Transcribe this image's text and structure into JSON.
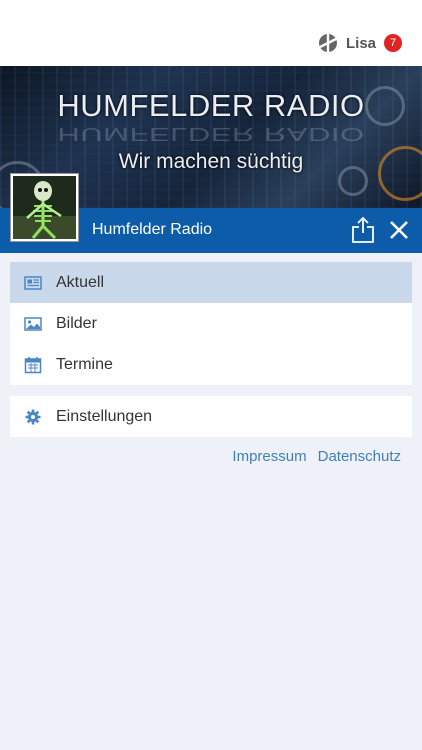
{
  "header": {
    "user_name": "Lisa",
    "notification_count": "7"
  },
  "banner": {
    "title": "HUMFELDER RADIO",
    "subtitle": "Wir machen süchtig"
  },
  "app": {
    "title": "Humfelder Radio"
  },
  "menu": {
    "items": [
      {
        "label": "Aktuell",
        "icon": "newspaper-icon",
        "active": true
      },
      {
        "label": "Bilder",
        "icon": "image-icon",
        "active": false
      },
      {
        "label": "Termine",
        "icon": "calendar-icon",
        "active": false
      }
    ],
    "settings": {
      "label": "Einstellungen",
      "icon": "gear-icon"
    }
  },
  "footer": {
    "impressum": "Impressum",
    "datenschutz": "Datenschutz"
  },
  "colors": {
    "primary": "#0d5caa",
    "active_row": "#c9d9eb",
    "link": "#3f7fbd",
    "badge": "#e02424",
    "background": "#eef2f8"
  }
}
